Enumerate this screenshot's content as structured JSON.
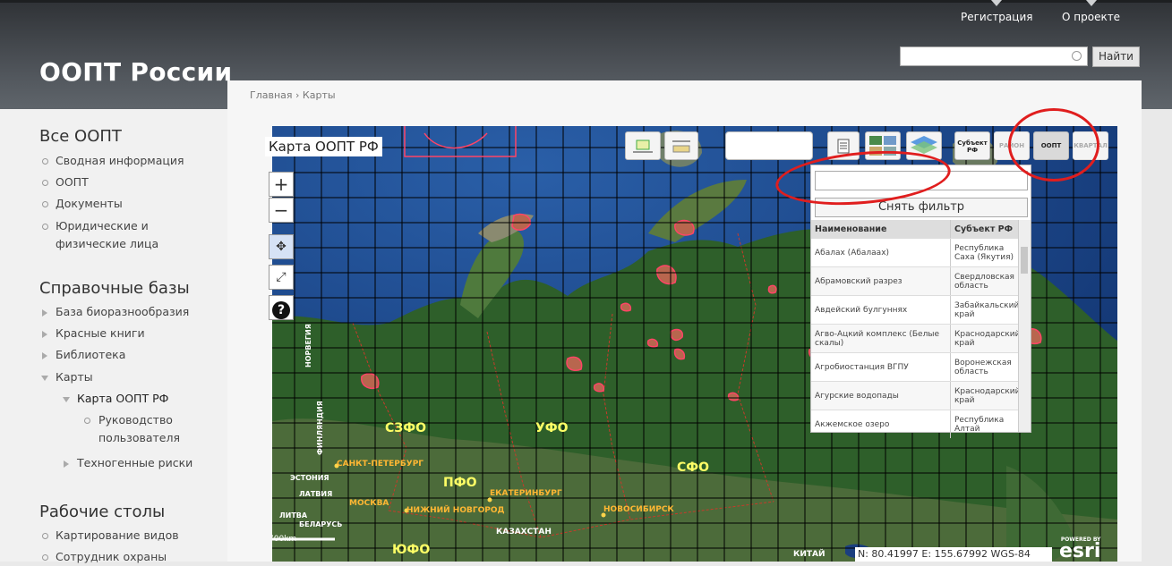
{
  "site": {
    "title": "ООПТ России"
  },
  "top_nav": {
    "register": "Регистрация",
    "about": "О проекте"
  },
  "search": {
    "placeholder": "",
    "button": "Найти"
  },
  "breadcrumb": {
    "home": "Главная",
    "sep": "›",
    "current": "Карты"
  },
  "sidebar": {
    "all_title": "Все ООПТ",
    "all_items": [
      "Сводная информация",
      "ООПТ",
      "Документы",
      "Юридические и физические лица"
    ],
    "ref_title": "Справочные базы",
    "ref_items": [
      "База биоразнообразия",
      "Красные книги",
      "Библиотека",
      "Карты",
      "Карта ООПТ РФ",
      "Руководство пользователя",
      "Техногенные риски"
    ],
    "desk_title": "Рабочие столы",
    "desk_items": [
      "Картирование видов",
      "Сотрудник охраны"
    ]
  },
  "map": {
    "title": "Карта ООПТ РФ",
    "zoom_in": "+",
    "zoom_out": "−",
    "help": "?",
    "toolbar": {
      "subject": "Субъект РФ",
      "rayon": "РАЙОН",
      "oopt": "ООПТ",
      "kvartal": "КВАРТАЛ"
    },
    "labels": {
      "szfo": "СЗФО",
      "ufo": "УФО",
      "sfo": "СФО",
      "pfo": "ПФО",
      "yufo": "ЮФО",
      "spb": "САНКТ-ПЕТЕРБУРГ",
      "moskva": "МОСКВА",
      "nnovgorod": "НИЖНИЙ НОВГОРОД",
      "ekb": "ЕКАТЕРИНБУРГ",
      "nsk": "НОВОСИБИРСК",
      "kz": "КАЗАХСТАН",
      "china": "КИТАЙ",
      "norway": "НОРВЕГИЯ",
      "finland": "ФИНЛЯНДИЯ",
      "estonia": "ЭСТОНИЯ",
      "latvia": "ЛАТВИЯ",
      "litva": "ЛИТВА",
      "belarus": "БЕЛАРУСЬ"
    },
    "scale": "700km",
    "coords": "N: 80.41997 E: 155.67992 WGS-84",
    "esri_powered": "POWERED BY",
    "esri_logo": "esri"
  },
  "panel": {
    "filter_button": "Снять фильтр",
    "col_name": "Наименование",
    "col_subject": "Субъект РФ",
    "rows": [
      {
        "name": "Абалах (Абалаах)",
        "subject": "Республика Саха (Якутия)"
      },
      {
        "name": "Абрамовский разрез",
        "subject": "Свердловская область"
      },
      {
        "name": "Авдейский булгуннях",
        "subject": "Забайкальский край"
      },
      {
        "name": "Агво-Ацкий комплекс (Белые скалы)",
        "subject": "Краснодарский край"
      },
      {
        "name": "Агробиостанция ВГПУ",
        "subject": "Воронежская область"
      },
      {
        "name": "Агурские водопады",
        "subject": "Краснодарский край"
      },
      {
        "name": "Акжемское озеро",
        "subject": "Республика Алтай"
      }
    ]
  },
  "colors": {
    "header": "#3d4146",
    "annotation": "#e01e1e",
    "region_label": "#ffff66",
    "city_label": "#ffb733"
  }
}
